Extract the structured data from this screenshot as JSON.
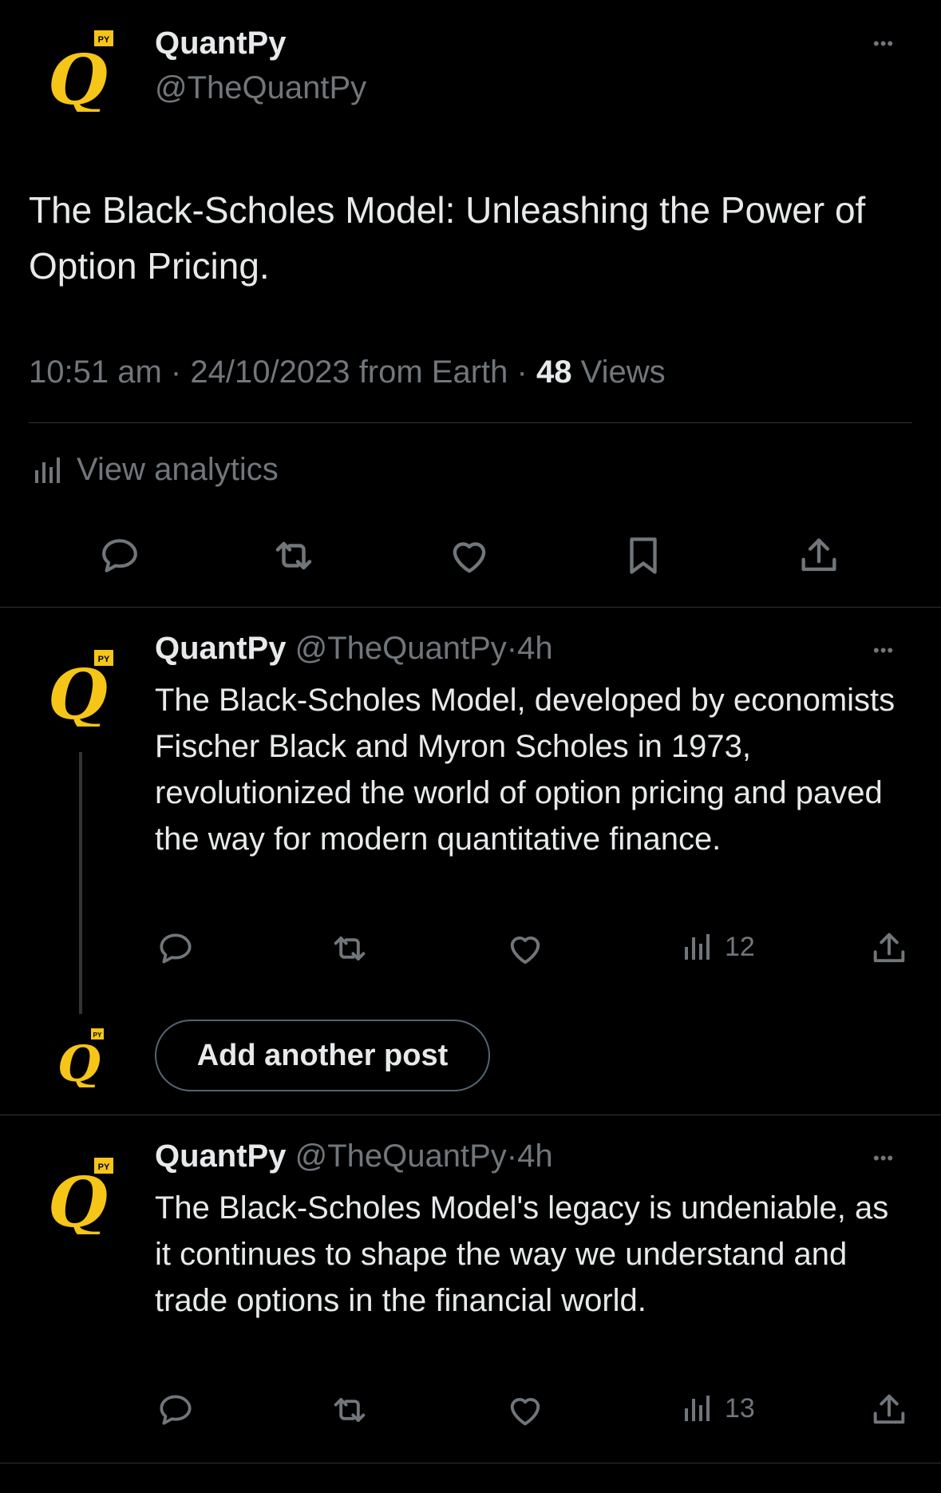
{
  "main_tweet": {
    "display_name": "QuantPy",
    "handle": "@TheQuantPy",
    "text": "The Black-Scholes Model: Unleashing the Power of Option Pricing.",
    "time": "10:51 am",
    "date": "24/10/2023",
    "source": "from Earth",
    "views_count": "48",
    "views_label": "Views",
    "analytics_label": "View analytics"
  },
  "thread": [
    {
      "display_name": "QuantPy",
      "handle": "@TheQuantPy",
      "age": "4h",
      "text": "The Black-Scholes Model, developed by economists Fischer Black and Myron Scholes in 1973, revolutionized the world of option pricing and paved the way for modern quantitative finance.",
      "views": "12"
    },
    {
      "display_name": "QuantPy",
      "handle": "@TheQuantPy",
      "age": "4h",
      "text": "The Black-Scholes Model's legacy is undeniable, as it continues to shape the way we understand and trade options in the financial world.",
      "views": "13"
    }
  ],
  "add_post": {
    "label": "Add another post"
  },
  "avatar": {
    "letter": "Q",
    "badge": "PY"
  },
  "separators": {
    "dot": "·",
    "more": "•••"
  },
  "colors": {
    "background": "#000000",
    "text": "#e7e9ea",
    "muted": "#71767b",
    "accent_yellow": "#f5c518",
    "divider": "#2f3336"
  }
}
